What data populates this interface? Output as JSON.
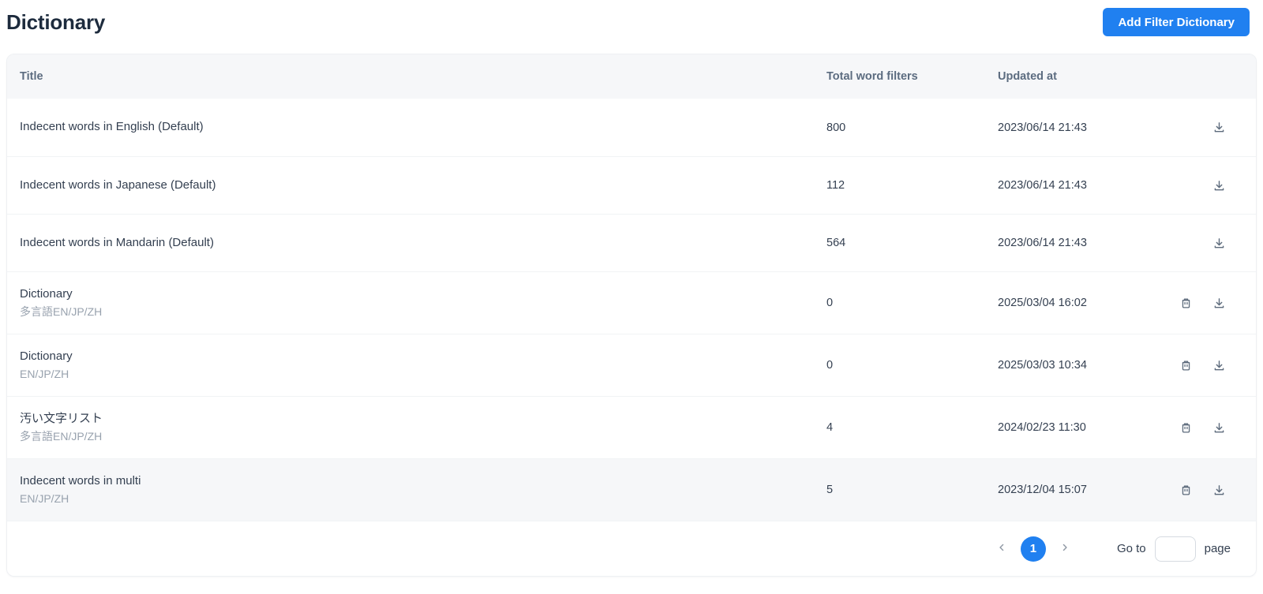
{
  "page_title": "Dictionary",
  "actions": {
    "add_filter_dictionary": "Add Filter Dictionary"
  },
  "table": {
    "columns": [
      {
        "key": "title",
        "label": "Title"
      },
      {
        "key": "total",
        "label": "Total word filters"
      },
      {
        "key": "updated",
        "label": "Updated at"
      }
    ],
    "rows": [
      {
        "title": "Indecent words in English (Default)",
        "subtitle": "",
        "total": "800",
        "updated": "2023/06/14 21:43",
        "deletable": false,
        "highlighted": false
      },
      {
        "title": "Indecent words in Japanese (Default)",
        "subtitle": "",
        "total": "112",
        "updated": "2023/06/14 21:43",
        "deletable": false,
        "highlighted": false
      },
      {
        "title": "Indecent words in Mandarin (Default)",
        "subtitle": "",
        "total": "564",
        "updated": "2023/06/14 21:43",
        "deletable": false,
        "highlighted": false
      },
      {
        "title": "Dictionary",
        "subtitle": "多言語EN/JP/ZH",
        "total": "0",
        "updated": "2025/03/04 16:02",
        "deletable": true,
        "highlighted": false
      },
      {
        "title": "Dictionary",
        "subtitle": "EN/JP/ZH",
        "total": "0",
        "updated": "2025/03/03 10:34",
        "deletable": true,
        "highlighted": false
      },
      {
        "title": "汚い文字リスト",
        "subtitle": "多言語EN/JP/ZH",
        "total": "4",
        "updated": "2024/02/23 11:30",
        "deletable": true,
        "highlighted": false
      },
      {
        "title": "Indecent words in multi",
        "subtitle": "EN/JP/ZH",
        "total": "5",
        "updated": "2023/12/04 15:07",
        "deletable": true,
        "highlighted": true
      }
    ]
  },
  "pagination": {
    "current_page": "1",
    "goto_label": "Go to",
    "page_label": "page",
    "goto_value": ""
  },
  "icons": {
    "delete": "trash-icon",
    "download": "download-icon",
    "prev": "chevron-left-icon",
    "next": "chevron-right-icon"
  },
  "colors": {
    "primary": "#2080f0",
    "heading": "#1d2b3d",
    "text": "#333f50",
    "subtitle": "#98a2ae",
    "header_text": "#5c6c80",
    "header_bg": "#f6f7f9",
    "divider": "#f1f3f5",
    "icon": "#5d6b7c"
  }
}
